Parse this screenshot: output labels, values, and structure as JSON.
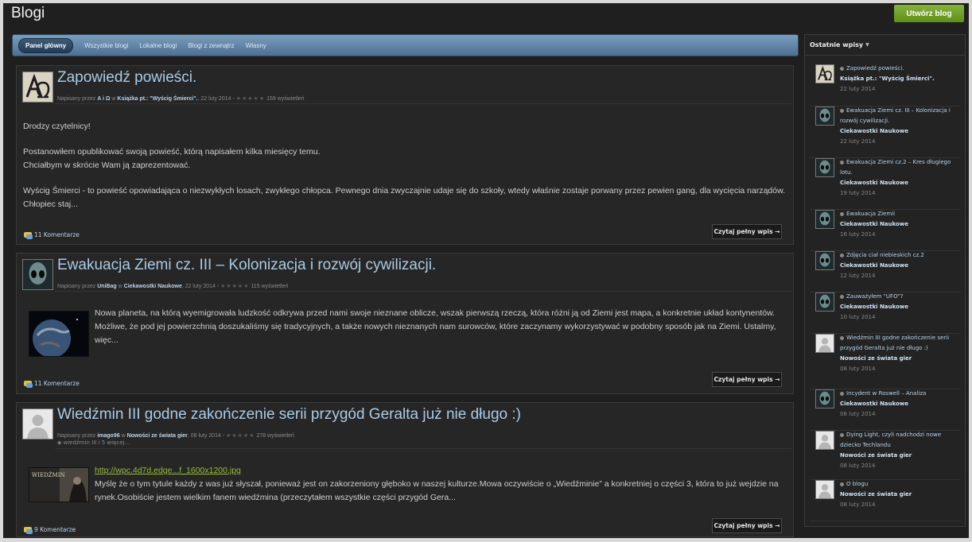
{
  "page": {
    "title": "Blogi",
    "create_button": "Utwórz blog"
  },
  "nav": {
    "tabs": [
      "Panel główny",
      "Wszystkie blogi",
      "Lokalne blogi",
      "Blogi z zewnątrz",
      "Własny"
    ]
  },
  "posts": [
    {
      "title": "Zapowiedź powieści.",
      "meta_prefix": "Napisany przez",
      "author": "A i Ω",
      "in_word": "w",
      "blog": "Książka pt.: \"Wyścig Śmierci\".",
      "date": ", 22 luty 2014 -",
      "stars": "★★★★★",
      "views": "159 wyświetleń",
      "body": [
        "Drodzy czytelnicy!",
        "Postanowiłem opublikować swoją powieść, którą napisałem kilka miesięcy temu.",
        "Chciałbym w skrócie Wam ją zaprezentować.",
        "Wyścig Śmierci - to powieść opowiadająca o niezwykłych losach, zwykłego chłopca. Pewnego dnia zwyczajnie udaje się do szkoły, wtedy właśnie zostaje porwany przez pewien gang, dla wycięcia narządów. Chłopiec staj..."
      ],
      "comments": "11 Komentarze",
      "read_more": "Czytaj pełny wpis →"
    },
    {
      "title": "Ewakuacja Ziemi cz. III – Kolonizacja i rozwój cywilizacji.",
      "meta_prefix": "Napisany przez",
      "author": "UniBag",
      "in_word": "w",
      "blog": "Ciekawostki Naukowe",
      "date": ", 22 luty 2014 -",
      "stars": "★★★★★",
      "views": "115 wyświetleń",
      "body": [
        "Nowa planeta, na którą wyemigrowała ludzkość odkrywa przed nami swoje nieznane oblicze, wszak pierwszą rzeczą, która różni ją od Ziemi jest mapa, a konkretnie układ kontynentów. Możliwe, że pod jej powierzchnią doszukaliśmy się tradycyjnych, a także nowych nieznanych nam surowców, które zaczynamy wykorzystywać w podobny sposób jak na Ziemi. Ustalmy, więc..."
      ],
      "comments": "11 Komentarze",
      "read_more": "Czytaj pełny wpis →"
    },
    {
      "title": "Wiedźmin III godne zakończenie serii przygód Geralta już nie długo :)",
      "meta_prefix": "Napisany przez",
      "author": "imago96",
      "in_word": "w",
      "blog": "Nowości ze świata gier",
      "date": ", 08 luty 2014 -",
      "stars": "★★★★★",
      "views": "278 wyświetleń",
      "tags": "wiedźmin III i 5 więcej...",
      "link": "http://wpc.4d7d.edge...f_1600x1200.jpg",
      "thumb_text": "WIEDŹMIN",
      "body": [
        "Myślę że o tym tytule każdy z was już słyszał, ponieważ jest on zakorzeniony głęboko w naszej kulturze.Mowa oczywiście o „Wiedźminie” a konkretniej o części 3, która to już wejdzie na rynek.Osobiście jestem wielkim fanem wiedźmina (przeczytałem wszystkie części przygód Gera..."
      ],
      "comments": "9 Komentarze",
      "read_more": "Czytaj pełny wpis →"
    }
  ],
  "sidebar": {
    "header": "Ostatnie wpisy",
    "items": [
      {
        "title": "Zapowiedź powieści.",
        "category": "Książka pt.: \"Wyścig Śmierci\".",
        "date": "22 luty 2014",
        "avatar": "logo"
      },
      {
        "title": "Ewakuacja Ziemi cz. III – Kolonizacja i rozwój cywilizacji.",
        "category": "Ciekawostki Naukowe",
        "date": "22 luty 2014",
        "avatar": "alien"
      },
      {
        "title": "Ewakuacja Ziemi cz.2 – Kres długiego lotu.",
        "category": "Ciekawostki Naukowe",
        "date": "19 luty 2014",
        "avatar": "alien"
      },
      {
        "title": "Ewakuacja Ziemii",
        "category": "Ciekawostki Naukowe",
        "date": "16 luty 2014",
        "avatar": "alien"
      },
      {
        "title": "Zdjęcia ciał niebieskich cz.2",
        "category": "Ciekawostki Naukowe",
        "date": "12 luty 2014",
        "avatar": "alien"
      },
      {
        "title": "Zauważyłem \"UFO\"?",
        "category": "Ciekawostki Naukowe",
        "date": "10 luty 2014",
        "avatar": "alien"
      },
      {
        "title": "Wiedźmin III godne zakończenie serii przygód Geralta już nie długo :)",
        "category": "Nowości ze świata gier",
        "date": "08 luty 2014",
        "avatar": "default"
      },
      {
        "title": "Incydent w Roswell – Analiza",
        "category": "Ciekawostki Naukowe",
        "date": "08 luty 2014",
        "avatar": "alien"
      },
      {
        "title": "Dying Light, czyli nadchodzi nowe dziecko Techlandu",
        "category": "Nowości ze świata gier",
        "date": "08 luty 2014",
        "avatar": "default"
      },
      {
        "title": "O blogu",
        "category": "Nowości ze świata gier",
        "date": "08 luty 2014",
        "avatar": "default"
      }
    ]
  }
}
